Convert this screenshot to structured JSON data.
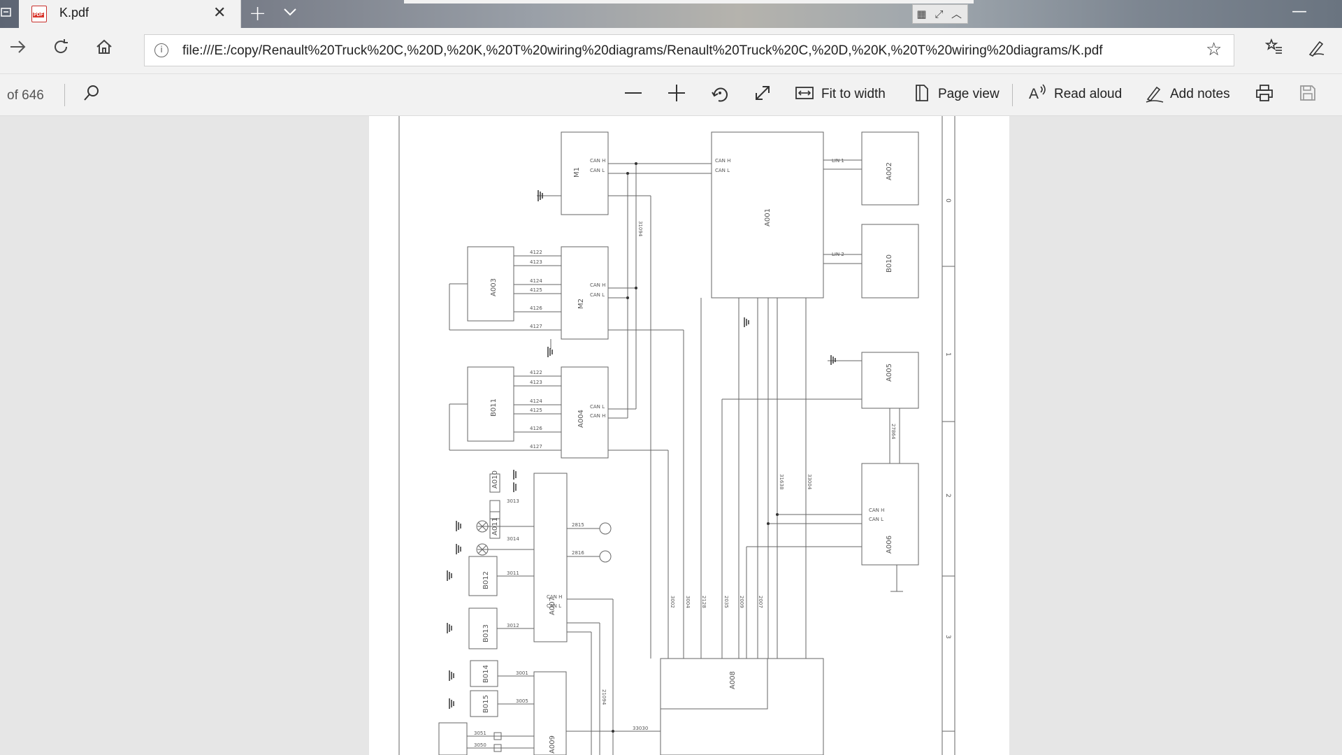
{
  "browser": {
    "tab": {
      "title": "K.pdf"
    },
    "address": {
      "url": "file:///E:/copy/Renault%20Truck%20C,%20D,%20K,%20T%20wiring%20diagrams/Renault%20Truck%20C,%20D,%20K,%20T%20wiring%20diagrams/K.pdf"
    }
  },
  "pdf_toolbar": {
    "page_count": "of 646",
    "fit_to_width": "Fit to width",
    "page_view": "Page view",
    "read_aloud": "Read aloud",
    "add_notes": "Add notes"
  },
  "icons": {
    "back": "back-arrow-icon",
    "refresh": "refresh-icon",
    "home": "home-icon",
    "favorite": "star-icon",
    "favorites_list": "favorites-list-icon",
    "sign": "pen-icon",
    "search": "search-icon",
    "zoom_out": "minus-icon",
    "zoom_in": "plus-icon",
    "rotate": "rotate-icon",
    "fullscreen": "expand-icon",
    "print": "print-icon",
    "save": "save-icon"
  },
  "diagram": {
    "components": {
      "c1": "M1",
      "c2": "A001",
      "c3": "A002",
      "c4": "B010",
      "c5": "A003",
      "c6": "M2",
      "c7": "B011",
      "c8": "A004",
      "c9": "A005",
      "c10": "A006",
      "c11": "A007",
      "c12": "A008",
      "c13": "B012",
      "c14": "B013",
      "c15": "A009",
      "c16": "B014",
      "c17": "B015",
      "c18": "A010",
      "c19": "A011"
    },
    "wires": {
      "can_h": "CAN H",
      "can_l": "CAN L",
      "lin1": "LIN 1",
      "lin2": "LIN 2",
      "w4122": "4122",
      "w4123": "4123",
      "w4124": "4124",
      "w4125": "4125",
      "w4126": "4126",
      "w4127": "4127",
      "w3013": "3013",
      "w3014": "3014",
      "w3011": "3011",
      "w3012": "3012",
      "w3001": "3001",
      "w3005": "3005",
      "w3051": "3051",
      "w3050": "3050",
      "w2815": "2815",
      "w2816": "2816",
      "w3002": "3002",
      "w3004": "3004",
      "w2128": "2128",
      "w2035": "2035",
      "w2009": "2009",
      "w2007": "2007",
      "w31638": "31638",
      "w33004": "33004",
      "w31094": "31094",
      "w33030": "33030",
      "w27864": "27864",
      "w21094": "21094"
    },
    "frame_markers": {
      "m1": "0",
      "m2": "1",
      "m3": "2",
      "m4": "3"
    }
  }
}
